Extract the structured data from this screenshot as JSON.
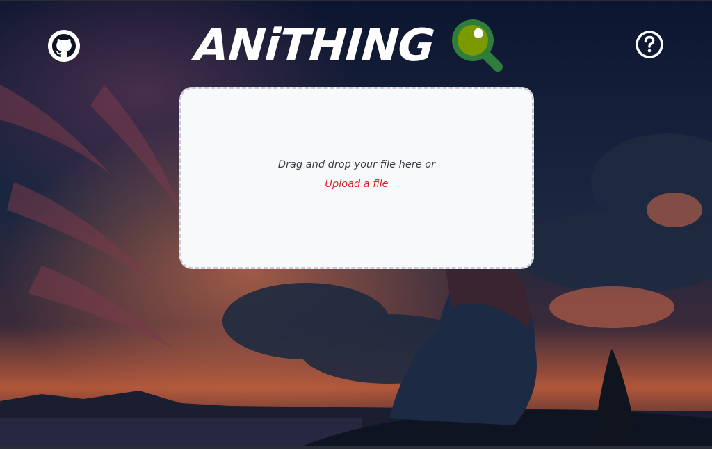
{
  "header": {
    "logo_text": "ANiTHING",
    "github_icon": "github-icon",
    "help_icon": "question-circle-icon"
  },
  "dropzone": {
    "instruction": "Drag and drop your file here or",
    "upload_link": "Upload a file"
  },
  "colors": {
    "logo_text": "#ffffff",
    "magnifier_lens": "#7a9a00",
    "magnifier_frame": "#2f7d3a",
    "upload_link": "#e0202a",
    "dropzone_bg": "#f8f9fb",
    "dropzone_border": "#c7ccd6"
  },
  "background": "anime night sky scene with girl sitting on hill"
}
